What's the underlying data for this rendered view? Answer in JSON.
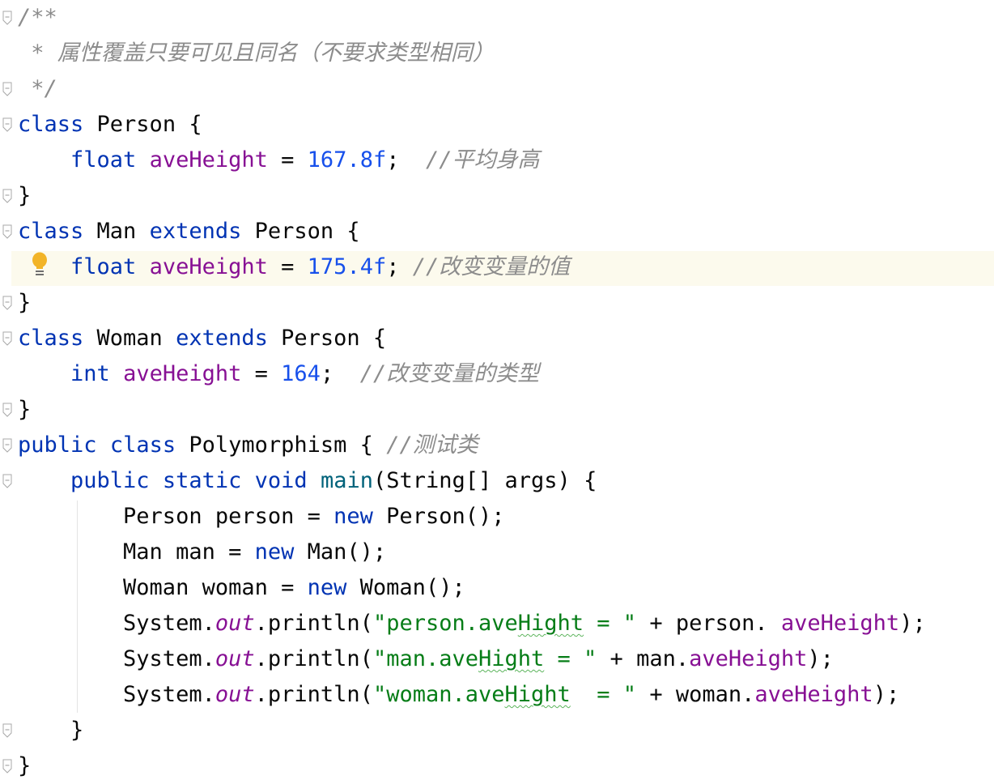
{
  "editor": {
    "colors": {
      "keyword": "#0033b3",
      "field": "#871094",
      "number": "#1750eb",
      "string": "#067d17",
      "comment": "#8c8c8c",
      "text": "#080808",
      "current_line": "#fcfaed",
      "bulb": "#f2b428"
    },
    "fold_marker_lines": [
      0,
      2,
      3,
      5,
      6,
      8,
      9,
      11,
      12,
      13,
      20,
      21
    ],
    "lines": [
      [
        {
          "t": "/**",
          "c": "cmt"
        }
      ],
      [
        {
          "t": " * 属性覆盖只要可见且同名（不要求类型相同）",
          "c": "cmt"
        }
      ],
      [
        {
          "t": " */",
          "c": "cmt"
        }
      ],
      [
        {
          "t": "class",
          "c": "kw"
        },
        {
          "t": " Person {"
        }
      ],
      [
        {
          "t": "    "
        },
        {
          "t": "float",
          "c": "kw"
        },
        {
          "t": " "
        },
        {
          "t": "aveHeight",
          "c": "fld"
        },
        {
          "t": " = "
        },
        {
          "t": "167.8f",
          "c": "num"
        },
        {
          "t": ";  "
        },
        {
          "t": "//平均身高",
          "c": "cmt"
        }
      ],
      [
        {
          "t": "}"
        }
      ],
      [
        {
          "t": "class",
          "c": "kw"
        },
        {
          "t": " Man "
        },
        {
          "t": "extends",
          "c": "kw"
        },
        {
          "t": " Person {"
        }
      ],
      [
        {
          "t": "    "
        },
        {
          "t": "float",
          "c": "kw"
        },
        {
          "t": " "
        },
        {
          "t": "aveHeight",
          "c": "fld"
        },
        {
          "t": " = "
        },
        {
          "t": "175.4f",
          "c": "num"
        },
        {
          "t": "; "
        },
        {
          "t": "//改变变量的值",
          "c": "cmt"
        }
      ],
      [
        {
          "t": "}"
        }
      ],
      [
        {
          "t": "class",
          "c": "kw"
        },
        {
          "t": " Woman "
        },
        {
          "t": "extends",
          "c": "kw"
        },
        {
          "t": " Person {"
        }
      ],
      [
        {
          "t": "    "
        },
        {
          "t": "int",
          "c": "kw"
        },
        {
          "t": " "
        },
        {
          "t": "aveHeight",
          "c": "fld"
        },
        {
          "t": " = "
        },
        {
          "t": "164",
          "c": "num"
        },
        {
          "t": ";  "
        },
        {
          "t": "//改变变量的类型",
          "c": "cmt"
        }
      ],
      [
        {
          "t": "}"
        }
      ],
      [
        {
          "t": "public",
          "c": "kw"
        },
        {
          "t": " "
        },
        {
          "t": "class",
          "c": "kw"
        },
        {
          "t": " Polymorphism { "
        },
        {
          "t": "//测试类",
          "c": "cmt"
        }
      ],
      [
        {
          "t": "    "
        },
        {
          "t": "public",
          "c": "kw"
        },
        {
          "t": " "
        },
        {
          "t": "static",
          "c": "kw"
        },
        {
          "t": " "
        },
        {
          "t": "void",
          "c": "kw"
        },
        {
          "t": " "
        },
        {
          "t": "main",
          "c": "fn"
        },
        {
          "t": "(String[] args) {"
        }
      ],
      [
        {
          "t": "        Person person = "
        },
        {
          "t": "new",
          "c": "kw"
        },
        {
          "t": " Person();"
        }
      ],
      [
        {
          "t": "        Man man = "
        },
        {
          "t": "new",
          "c": "kw"
        },
        {
          "t": " Man();"
        }
      ],
      [
        {
          "t": "        Woman woman = "
        },
        {
          "t": "new",
          "c": "kw"
        },
        {
          "t": " Woman();"
        }
      ],
      [
        {
          "t": "        System."
        },
        {
          "t": "out",
          "c": "sfld"
        },
        {
          "t": ".println("
        },
        {
          "t": "\"person.ave",
          "c": "str"
        },
        {
          "t": "Hight",
          "c": "str typo"
        },
        {
          "t": " = \"",
          "c": "str"
        },
        {
          "t": " + person. "
        },
        {
          "t": "aveHeight",
          "c": "fld"
        },
        {
          "t": ");"
        }
      ],
      [
        {
          "t": "        System."
        },
        {
          "t": "out",
          "c": "sfld"
        },
        {
          "t": ".println("
        },
        {
          "t": "\"man.ave",
          "c": "str"
        },
        {
          "t": "Hight",
          "c": "str typo"
        },
        {
          "t": " = \"",
          "c": "str"
        },
        {
          "t": " + man."
        },
        {
          "t": "aveHeight",
          "c": "fld"
        },
        {
          "t": ");"
        }
      ],
      [
        {
          "t": "        System."
        },
        {
          "t": "out",
          "c": "sfld"
        },
        {
          "t": ".println("
        },
        {
          "t": "\"woman.ave",
          "c": "str"
        },
        {
          "t": "Hight",
          "c": "str typo"
        },
        {
          "t": "  = \"",
          "c": "str"
        },
        {
          "t": " + woman."
        },
        {
          "t": "aveHeight",
          "c": "fld"
        },
        {
          "t": ");"
        }
      ],
      [
        {
          "t": "    }"
        }
      ],
      [
        {
          "t": "}"
        }
      ]
    ]
  }
}
